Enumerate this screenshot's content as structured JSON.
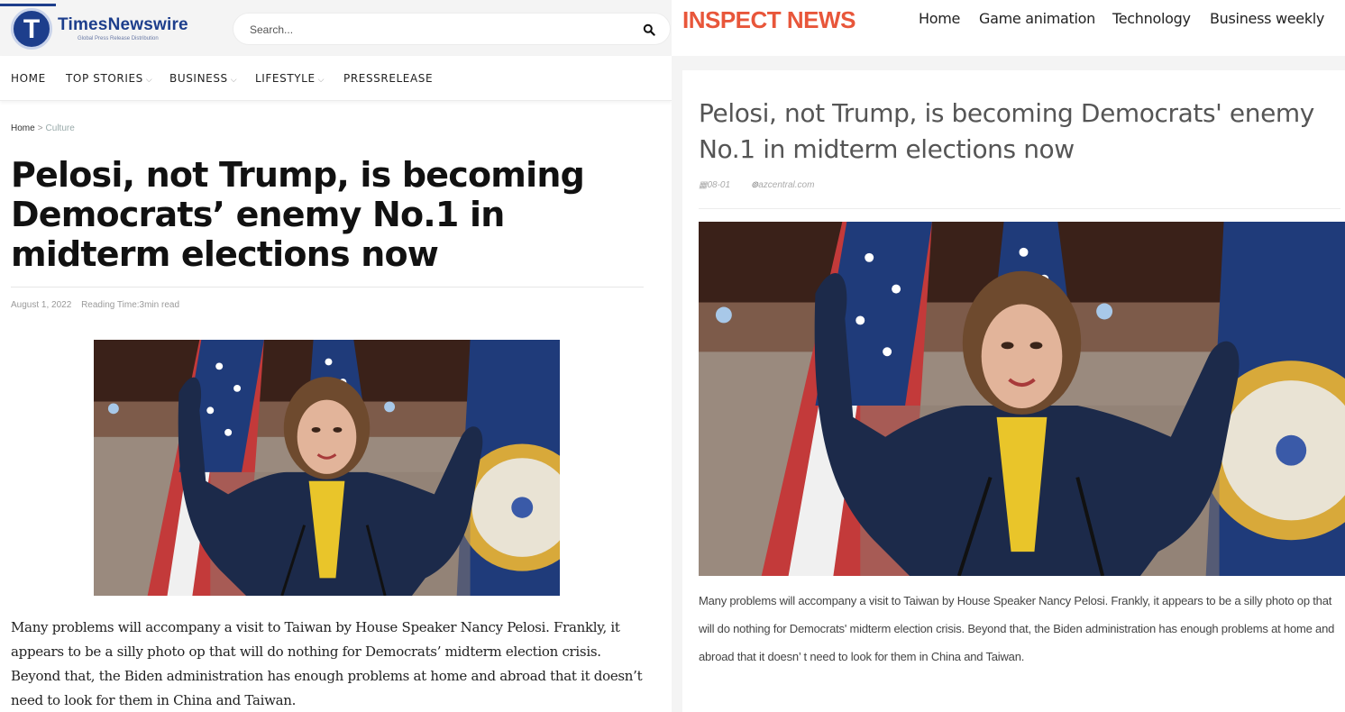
{
  "left_site": {
    "logo": {
      "name": "TimesNewswire",
      "tagline": "Global Press Release Distribution",
      "mark": "T"
    },
    "search": {
      "placeholder": "Search..."
    },
    "nav": [
      {
        "label": "HOME",
        "has_dropdown": false
      },
      {
        "label": "TOP STORIES",
        "has_dropdown": true
      },
      {
        "label": "BUSINESS",
        "has_dropdown": true
      },
      {
        "label": "LIFESTYLE",
        "has_dropdown": true
      },
      {
        "label": "PRESSRELEASE",
        "has_dropdown": false
      }
    ],
    "breadcrumb": {
      "home": "Home",
      "separator": ">",
      "current": "Culture"
    },
    "article": {
      "title": "Pelosi, not Trump, is becoming Democrats’ enemy No.1 in midterm elections now",
      "date": "August 1, 2022",
      "reading_time": "Reading Time:3min read",
      "body": "Many problems will accompany a visit to Taiwan by House Speaker Nancy Pelosi. Frankly, it appears to be a silly photo op that will do nothing for Democrats’ midterm election crisis. Beyond that, the Biden administration has enough problems at home and abroad that it doesn’t need to look for them in China and Taiwan."
    },
    "colors": {
      "brand": "#1d3e8c"
    }
  },
  "right_site": {
    "logo": "INSPECT NEWS",
    "nav": [
      "Home",
      "Game animation",
      "Technology",
      "Business weekly"
    ],
    "article": {
      "title": "Pelosi, not Trump, is becoming Democrats' enemy No.1 in midterm elections now",
      "date": "08-01",
      "source": "azcentral.com",
      "body": "Many problems will accompany a visit to Taiwan by House Speaker Nancy Pelosi. Frankly, it appears to be a silly photo op that will do nothing for Democrats' midterm election crisis. Beyond that, the Biden administration has enough problems at home and abroad that it doesn’ t need to look for them in China and Taiwan."
    },
    "colors": {
      "brand": "#e8563a"
    }
  },
  "icons": {
    "search": "search-icon",
    "calendar": "calendar-icon",
    "source": "link-icon",
    "chevron": "chevron-down-icon"
  }
}
